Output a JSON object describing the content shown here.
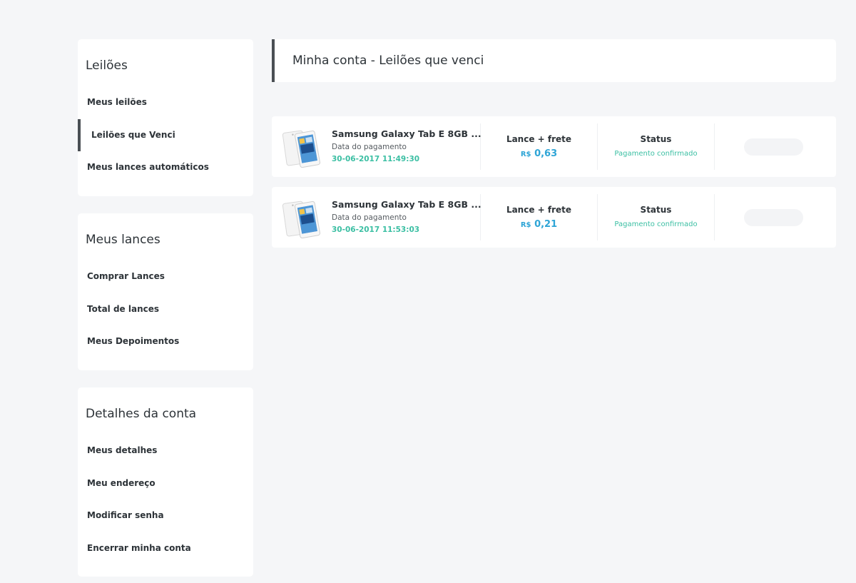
{
  "sidebar": {
    "sections": [
      {
        "title": "Leilões",
        "items": [
          "Meus leilões",
          "Leilões que Venci",
          "Meus lances automáticos"
        ]
      },
      {
        "title": "Meus lances",
        "items": [
          "Comprar Lances",
          "Total de lances",
          "Meus Depoimentos"
        ]
      },
      {
        "title": "Detalhes da conta",
        "items": [
          "Meus detalhes",
          "Meu endereço",
          "Modificar senha",
          "Encerrar minha conta"
        ]
      }
    ],
    "active_item": "Leilões que Venci"
  },
  "header": {
    "title": "Minha conta - Leilões que venci"
  },
  "auctions": [
    {
      "name": "Samsung Galaxy Tab E 8GB ...",
      "date_label": "Data do pagamento",
      "date": "30-06-2017 11:49:30",
      "price_label": "Lance + frete",
      "currency": "R$",
      "price": "0,63",
      "status_label": "Status",
      "status": "Pagamento confirmado"
    },
    {
      "name": "Samsung Galaxy Tab E 8GB ...",
      "date_label": "Data do pagamento",
      "date": "30-06-2017 11:53:03",
      "price_label": "Lance + frete",
      "currency": "R$",
      "price": "0,21",
      "status_label": "Status",
      "status": "Pagamento confirmado"
    }
  ],
  "colors": {
    "accent_teal": "#3bbfa3",
    "price_blue": "#2fa5d6",
    "active_bar": "#4a4f54"
  }
}
